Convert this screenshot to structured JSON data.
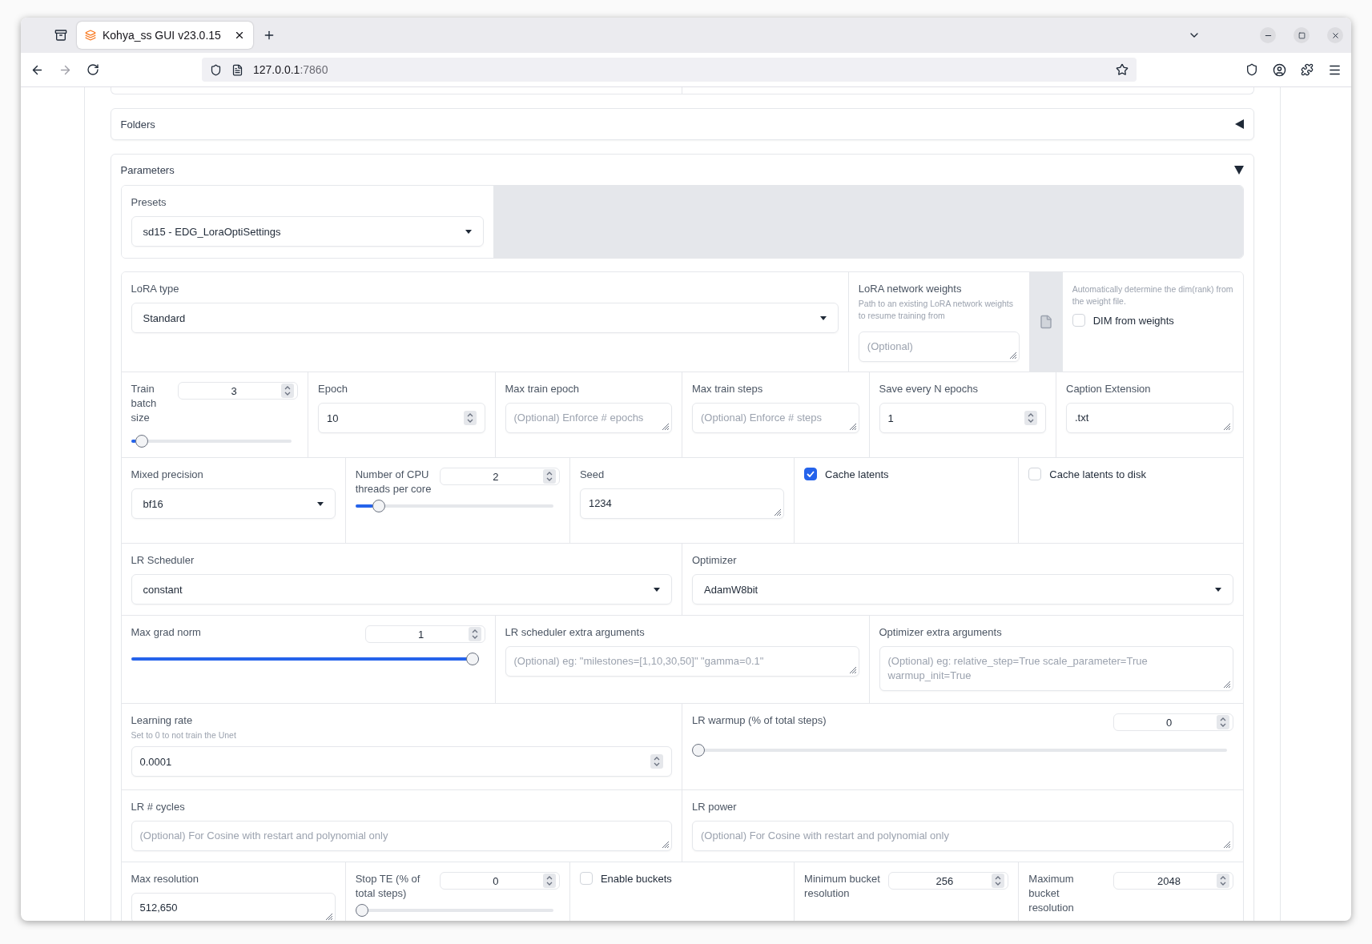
{
  "browser": {
    "tab_title": "Kohya_ss GUI v23.0.15",
    "url_host": "127.0.0.1",
    "url_port": ":7860"
  },
  "folders": {
    "title": "Folders",
    "expanded": false
  },
  "parameters": {
    "title": "Parameters",
    "expanded": true,
    "presets": {
      "label": "Presets",
      "value": "sd15 - EDG_LoraOptiSettings"
    },
    "groups": [
      {
        "cells": [
          {
            "kind": "dropdown",
            "label": "LoRA type",
            "value": "Standard"
          },
          {
            "kind": "textarea",
            "label": "LoRA network weights",
            "info": "Path to an existing LoRA network weights to resume training from",
            "placeholder": "(Optional)"
          },
          {
            "kind": "file_button"
          },
          {
            "kind": "checkbox",
            "info": "Automatically determine the dim(rank) from the weight file.",
            "label": "DIM from weights",
            "checked": false
          }
        ]
      },
      {
        "cells": [
          {
            "kind": "slider",
            "label": "Train batch size",
            "value": "3",
            "level": 0.03
          },
          {
            "kind": "number",
            "label": "Epoch",
            "value": "10"
          },
          {
            "kind": "textarea",
            "label": "Max train epoch",
            "placeholder": "(Optional) Enforce # epochs"
          },
          {
            "kind": "textarea",
            "label": "Max train steps",
            "placeholder": "(Optional) Enforce # steps"
          },
          {
            "kind": "number",
            "label": "Save every N epochs",
            "value": "1"
          },
          {
            "kind": "textarea",
            "label": "Caption Extension",
            "value": ".txt"
          }
        ]
      },
      {
        "cells": [
          {
            "kind": "dropdown",
            "label": "Mixed precision",
            "value": "bf16"
          },
          {
            "kind": "slider",
            "label": "Number of CPU threads per core",
            "value": "2",
            "level": 0.09
          },
          {
            "kind": "textarea",
            "label": "Seed",
            "value": "1234"
          },
          {
            "kind": "checkbox",
            "label": "Cache latents",
            "checked": true
          },
          {
            "kind": "checkbox",
            "label": "Cache latents to disk",
            "checked": false
          }
        ]
      },
      {
        "cells": [
          {
            "kind": "dropdown",
            "label": "LR Scheduler",
            "value": "constant"
          },
          {
            "kind": "dropdown",
            "label": "Optimizer",
            "value": "AdamW8bit"
          }
        ]
      },
      {
        "cells": [
          {
            "kind": "slider",
            "label": "Max grad norm",
            "value": "1",
            "level": 1
          },
          {
            "kind": "textarea",
            "label": "LR scheduler extra arguments",
            "placeholder": "(Optional) eg: \"milestones=[1,10,30,50]\" \"gamma=0.1\""
          },
          {
            "kind": "textarea",
            "label": "Optimizer extra arguments",
            "placeholder": "(Optional) eg: relative_step=True scale_parameter=True warmup_init=True"
          }
        ]
      },
      {
        "cells": [
          {
            "kind": "number",
            "label": "Learning rate",
            "info": "Set to 0 to not train the Unet",
            "value": "0.0001"
          },
          {
            "kind": "slider",
            "label": "LR warmup (% of total steps)",
            "value": "0",
            "level": 0
          }
        ]
      },
      {
        "cells": [
          {
            "kind": "textarea",
            "label": "LR # cycles",
            "placeholder": "(Optional) For Cosine with restart and polynomial only"
          },
          {
            "kind": "textarea",
            "label": "LR power",
            "placeholder": "(Optional) For Cosine with restart and polynomial only"
          }
        ]
      },
      {
        "cells": [
          {
            "kind": "textarea",
            "label": "Max resolution",
            "value": "512,650"
          },
          {
            "kind": "slider",
            "label": "Stop TE (% of total steps)",
            "value": "0",
            "level": 0
          },
          {
            "kind": "checkbox",
            "label": "Enable buckets",
            "checked": false
          },
          {
            "kind": "number_head",
            "label": "Minimum bucket resolution",
            "value": "256"
          },
          {
            "kind": "number_head",
            "label": "Maximum bucket resolution",
            "value": "2048"
          }
        ]
      }
    ]
  }
}
